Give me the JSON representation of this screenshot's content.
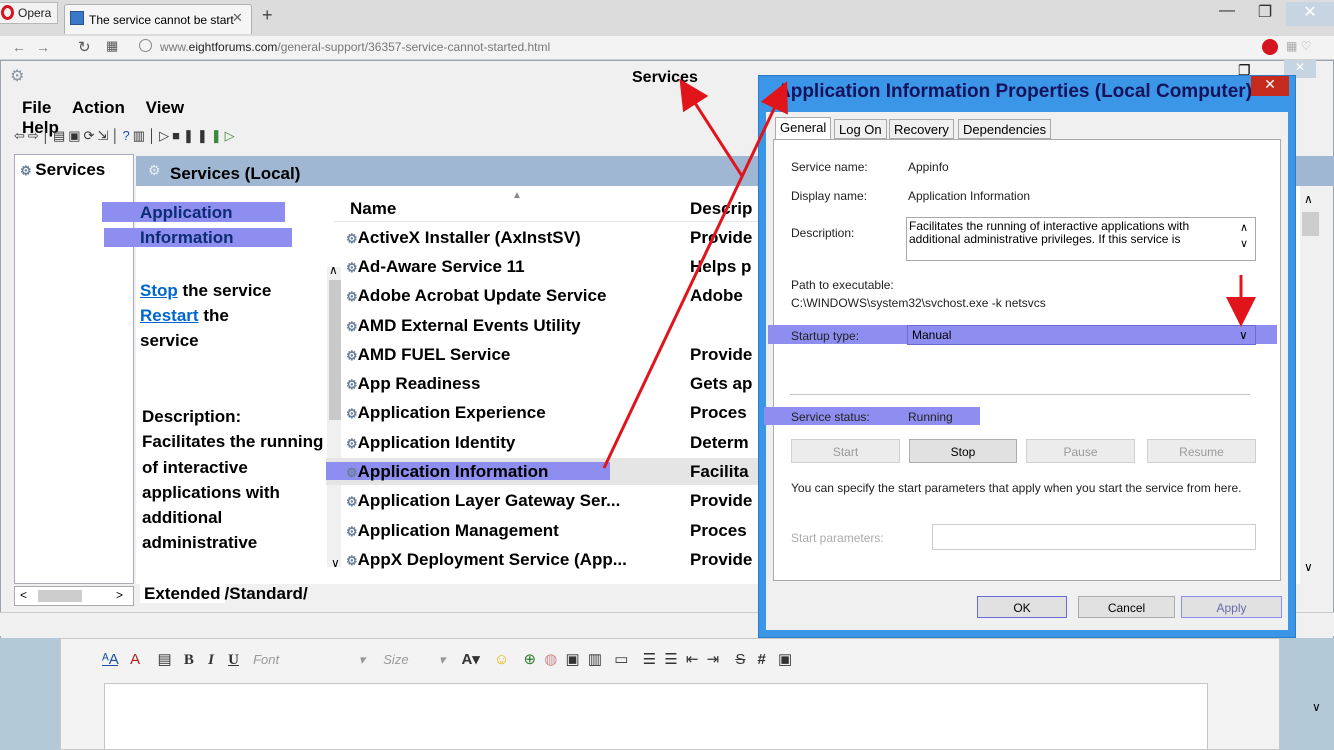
{
  "browser": {
    "opera_label": "Opera",
    "tab_title": "The service cannot be start",
    "new_tab": "+",
    "url_prefix": "www.",
    "url_domain": "eightforums.com",
    "url_path": "/general-support/36357-service-cannot-started.html"
  },
  "services": {
    "title": "Services",
    "menu": [
      "File",
      "Action",
      "View",
      "Help"
    ],
    "tree_item": "Services",
    "pane_header": "Services (Local)",
    "selected_title_1": "Application",
    "selected_title_2": "Information",
    "stop_link": "Stop",
    "stop_rest": " the service",
    "restart_link": "Restart",
    "restart_rest": " the",
    "restart_rest2": "service",
    "description_label": "Description:",
    "description_text": "Facilitates the running of interactive applications with additional administrative",
    "col_name": "Name",
    "col_desc": "Descrip",
    "rows": [
      {
        "name": "ActiveX Installer (AxInstSV)",
        "desc": "Provide"
      },
      {
        "name": "Ad-Aware Service 11",
        "desc": "Helps p"
      },
      {
        "name": "Adobe Acrobat Update Service",
        "desc": "Adobe"
      },
      {
        "name": "AMD External Events Utility",
        "desc": ""
      },
      {
        "name": "AMD FUEL Service",
        "desc": "Provide"
      },
      {
        "name": "App Readiness",
        "desc": "Gets ap"
      },
      {
        "name": "Application Experience",
        "desc": "Proces"
      },
      {
        "name": "Application Identity",
        "desc": "Determ"
      },
      {
        "name": "Application Information",
        "desc": "Facilita"
      },
      {
        "name": "Application Layer Gateway Ser...",
        "desc": "Provide"
      },
      {
        "name": "Application Management",
        "desc": "Proces"
      },
      {
        "name": "AppX Deployment Service (App...",
        "desc": "Provide"
      }
    ],
    "tab_extended": "Extended",
    "tab_standard": "Standard"
  },
  "dialog": {
    "title": "Application Information Properties (Local Computer)",
    "tabs": [
      "General",
      "Log On",
      "Recovery",
      "Dependencies"
    ],
    "service_name_label": "Service name:",
    "service_name": "Appinfo",
    "display_name_label": "Display name:",
    "display_name": "Application Information",
    "description_label": "Description:",
    "description": "Facilitates the running of interactive applications with additional administrative privileges.  If this service is",
    "path_label": "Path to executable:",
    "path": "C:\\WINDOWS\\system32\\svchost.exe -k netsvcs",
    "startup_label": "Startup type:",
    "startup_value": "Manual",
    "status_label": "Service status:",
    "status_value": "Running",
    "btn_start": "Start",
    "btn_stop": "Stop",
    "btn_pause": "Pause",
    "btn_resume": "Resume",
    "hint": "You can specify the start parameters that apply when you start the service from here.",
    "start_params_label": "Start parameters:",
    "ok": "OK",
    "cancel": "Cancel",
    "apply": "Apply"
  },
  "editor": {
    "font_placeholder": "Font",
    "size_placeholder": "Size"
  },
  "colors": {
    "highlight": "#8e8ef0",
    "arrow": "#e0141a",
    "dialog_frame": "#3b96e8"
  }
}
